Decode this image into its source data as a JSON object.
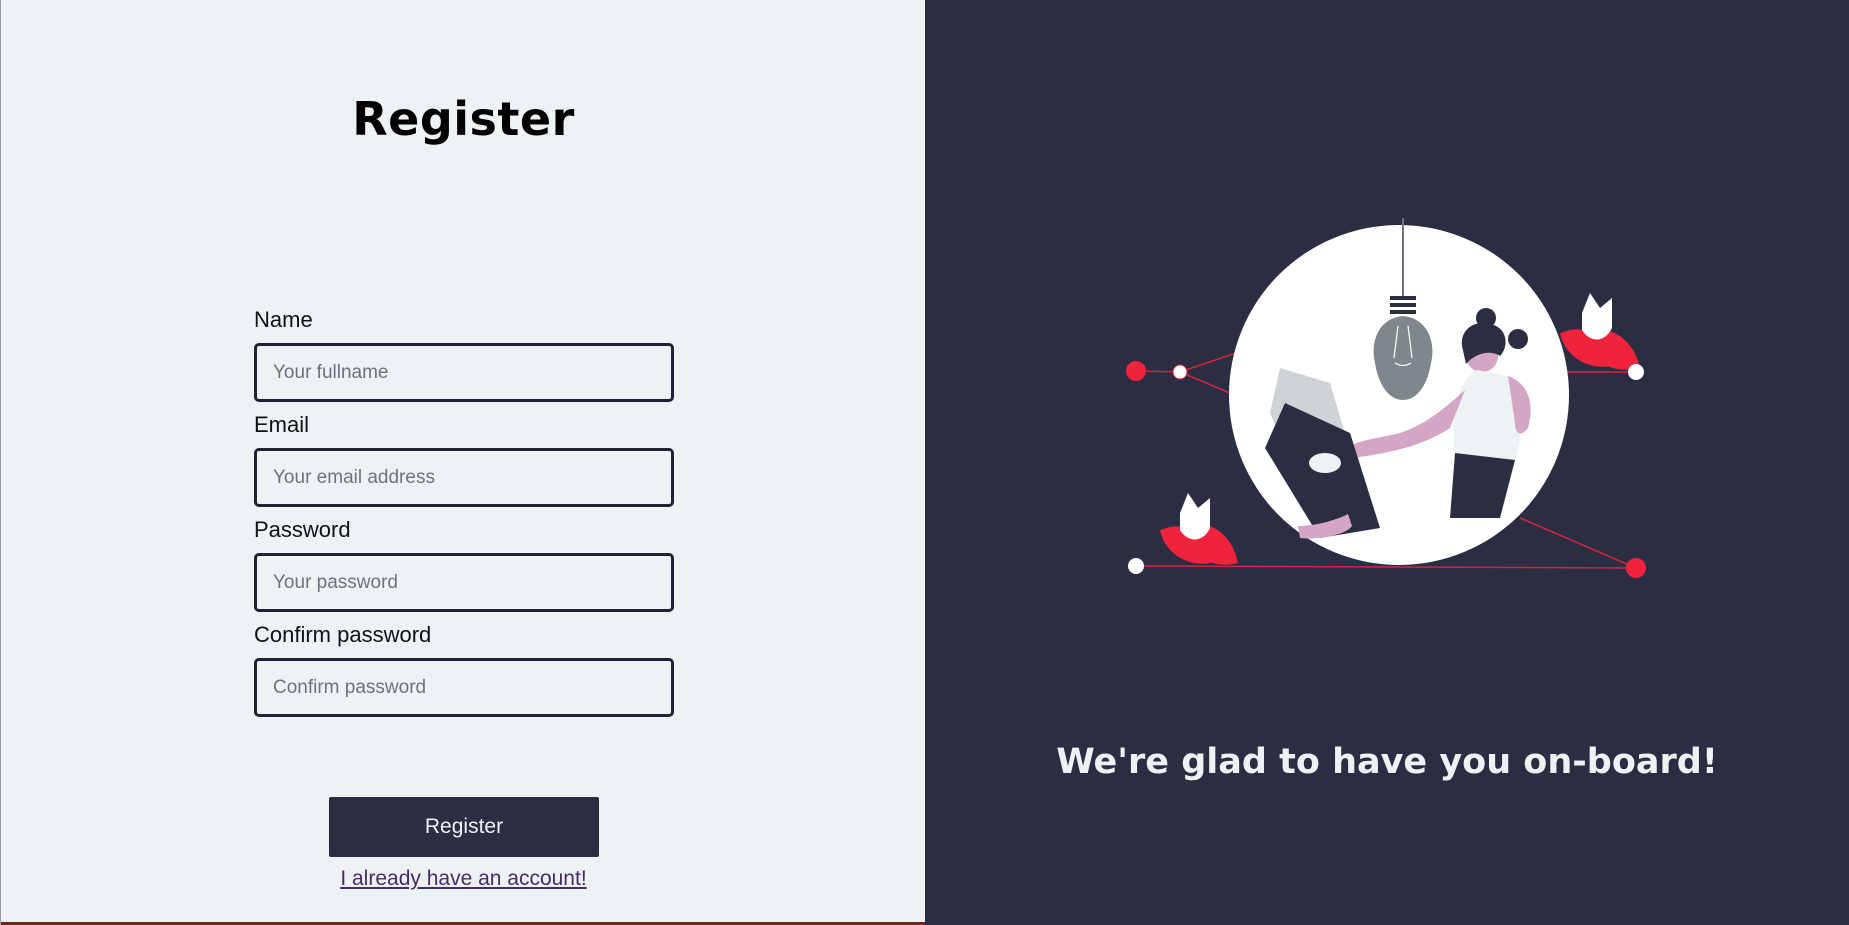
{
  "form": {
    "title": "Register",
    "fields": [
      {
        "label": "Name",
        "placeholder": "Your fullname",
        "value": ""
      },
      {
        "label": "Email",
        "placeholder": "Your email address",
        "value": ""
      },
      {
        "label": "Password",
        "placeholder": "Your password",
        "value": ""
      },
      {
        "label": "Confirm password",
        "placeholder": "Confirm password",
        "value": ""
      }
    ],
    "submit_label": "Register",
    "login_link": "I already have an account!"
  },
  "hero": {
    "tagline": "We're glad to have you on-board!",
    "illustration_icon": "woman-reading-book-illustration"
  },
  "colors": {
    "background_light": "#edf2f4",
    "background_dark": "#2b2d42",
    "accent_red": "#ef233c",
    "muted_pink": "#d4a5c4"
  }
}
